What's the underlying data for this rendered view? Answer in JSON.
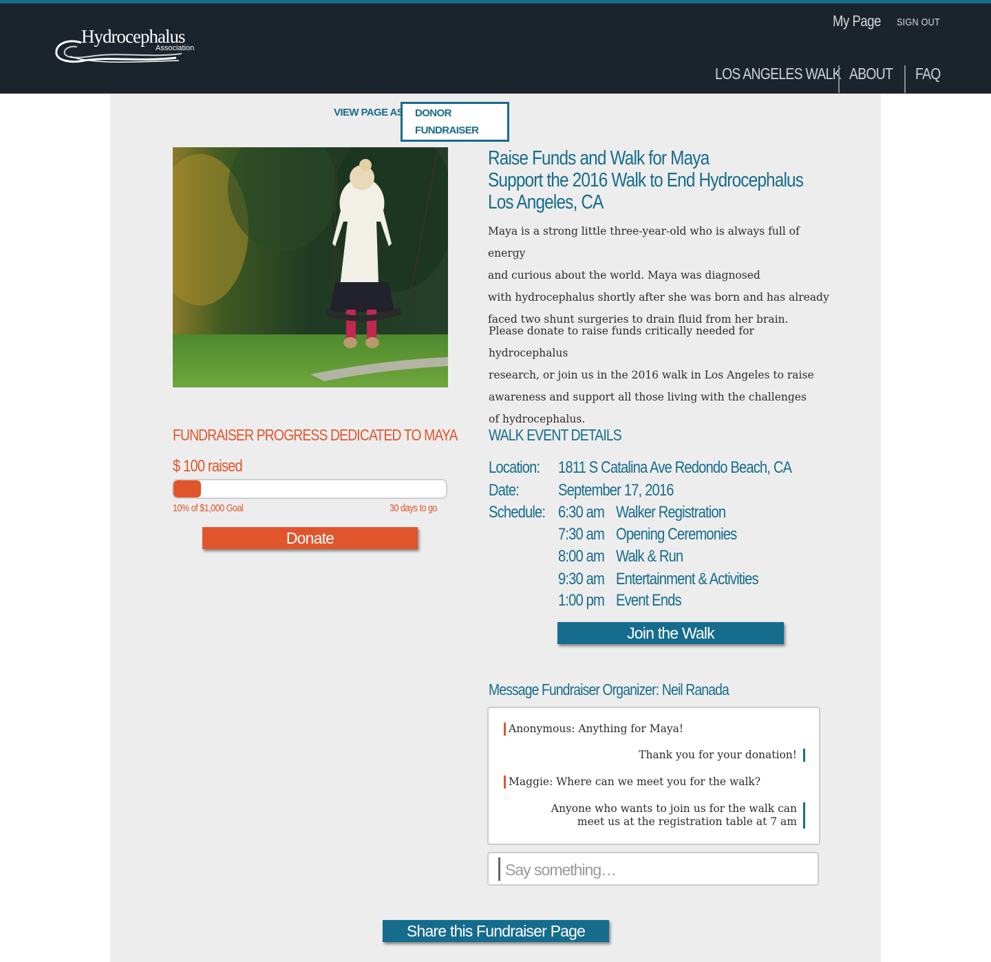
{
  "header": {
    "logo_main": "Hydrocephalus",
    "logo_sub": "Association",
    "my_page": "My Page",
    "sign_out": "SIGN OUT",
    "nav": [
      "LOS ANGELES WALK",
      "ABOUT",
      "FAQ"
    ]
  },
  "view_as": {
    "label": "VIEW PAGE AS:",
    "options": [
      "DONOR",
      "FUNDRAISER"
    ]
  },
  "intro": {
    "title_lines": [
      "Raise Funds and Walk for Maya",
      "Support the 2016 Walk to End Hydrocephalus",
      "Los Angeles, CA"
    ],
    "paragraph1": [
      "Maya is a strong little three-year-old who is always full of energy",
      "and curious about the world.  Maya was diagnosed",
      "with hydrocephalus shortly after she was born and has already",
      "faced two shunt surgeries to drain fluid from her brain."
    ],
    "paragraph2": [
      "Please donate to raise funds critically needed for hydrocephalus",
      "research, or join us in the 2016 walk in Los Angeles to raise",
      "awareness and support all those living with the challenges",
      "of hydrocephalus."
    ]
  },
  "progress": {
    "heading": "FUNDRAISER PROGRESS DEDICATED TO MAYA",
    "raised": "$ 100 raised",
    "percent": 10,
    "goal_text": "10% of $1,000 Goal",
    "days_text": "30 days to go",
    "donate_label": "Donate"
  },
  "walk": {
    "heading": "WALK EVENT DETAILS",
    "location_label": "Location:",
    "location": "1811 S Catalina Ave Redondo Beach, CA",
    "date_label": "Date:",
    "date": "September 17, 2016",
    "schedule_label": "Schedule:",
    "schedule": [
      {
        "time": "6:30 am",
        "event": "Walker Registration"
      },
      {
        "time": "7:30 am",
        "event": "Opening Ceremonies"
      },
      {
        "time": "8:00 am",
        "event": "Walk & Run"
      },
      {
        "time": "9:30 am",
        "event": "Entertainment & Activities"
      },
      {
        "time": "1:00 pm",
        "event": "Event Ends"
      }
    ],
    "join_label": "Join the Walk"
  },
  "messages": {
    "heading": "Message Fundraiser Organizer: Neil Ranada",
    "items": [
      {
        "side": "left",
        "lines": [
          "Anonymous:  Anything for Maya!"
        ]
      },
      {
        "side": "right",
        "lines": [
          "Thank you for your donation!"
        ]
      },
      {
        "side": "left",
        "lines": [
          "Maggie:  Where can we meet you for the walk?"
        ]
      },
      {
        "side": "right",
        "lines": [
          "Anyone who wants to join us for the walk  can",
          "meet us at the registration table at 7 am"
        ]
      }
    ],
    "placeholder": "Say something…"
  },
  "share_label": "Share this Fundraiser Page",
  "colors": {
    "header_bg": "#1b242d",
    "accent_teal": "#156c8d",
    "accent_orange": "#e0552c",
    "card_bg": "#ededed"
  }
}
